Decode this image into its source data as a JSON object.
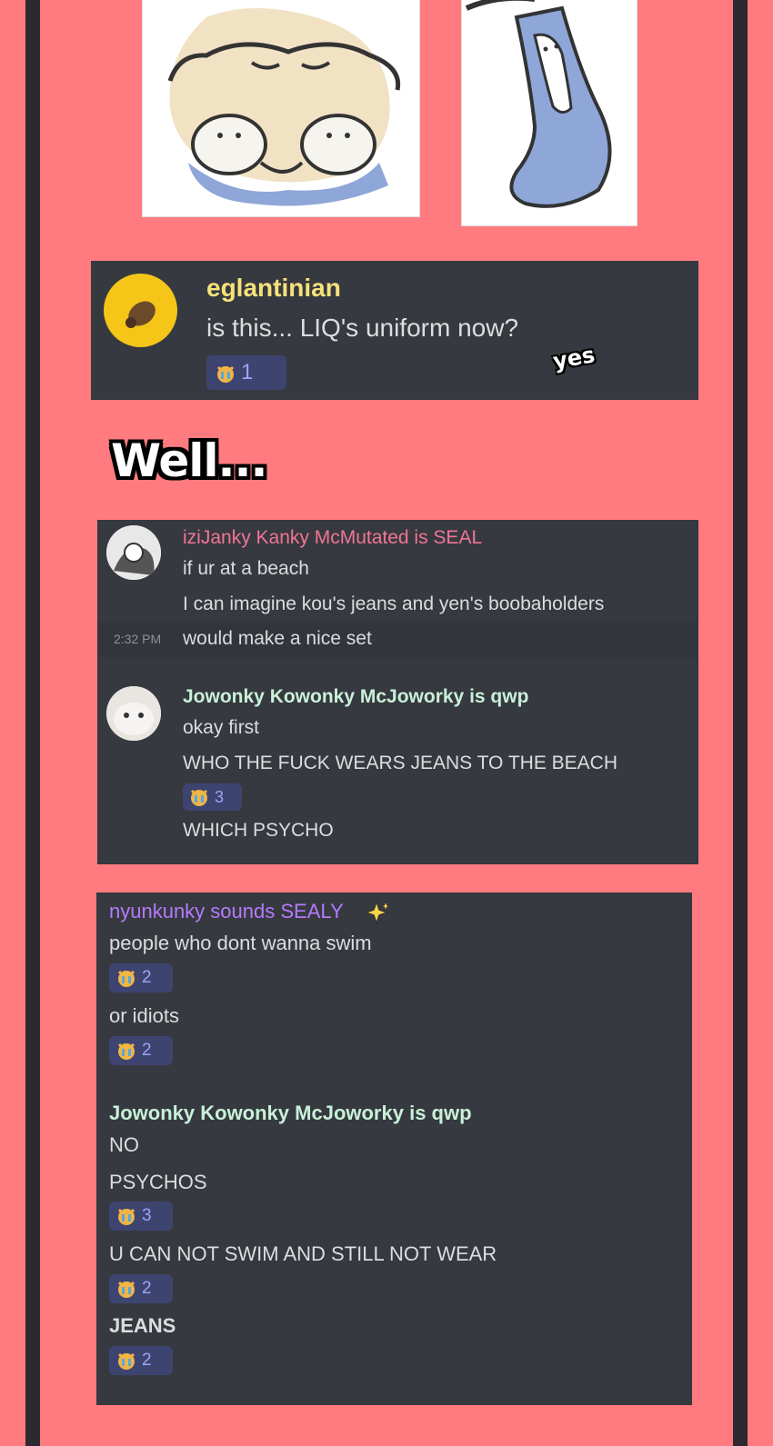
{
  "top_caption": "yes",
  "section_title": "Well...",
  "post1": {
    "author": "eglantinian",
    "author_color": "#f7e27a",
    "message": "is this... LIQ's uniform now?",
    "reaction": {
      "emoji": "crying-cat-emoji",
      "count": "1"
    }
  },
  "chat1": {
    "author1": "iziJanky Kanky McMutated is SEAL",
    "author1_color": "#f27596",
    "lines1": [
      "if ur at a beach",
      "I can imagine kou's jeans and yen's boobaholders",
      "would make a nice set"
    ],
    "timestamp": "2:32 PM",
    "author2": "Jowonky Kowonky McJoworky is qwp",
    "author2_color": "#c9f0d8",
    "lines2": [
      "okay first",
      "WHO THE FUCK WEARS JEANS TO THE BEACH",
      "WHICH PSYCHO"
    ],
    "reaction2": "3"
  },
  "chat2": {
    "author1": "nyunkunky sounds SEALY",
    "author1_color": "#b57aff",
    "author1_icon": "sparkles-icon",
    "lines1": [
      "people who dont wanna swim",
      "or idiots"
    ],
    "reactions1": [
      "2",
      "2"
    ],
    "author2": "Jowonky Kowonky McJoworky is qwp",
    "author2_color": "#c9f0d8",
    "lines2": [
      "NO",
      "PSYCHOS",
      "U CAN NOT SWIM AND STILL NOT WEAR",
      "JEANS"
    ],
    "reactions2": [
      "3",
      "2",
      "2"
    ]
  }
}
